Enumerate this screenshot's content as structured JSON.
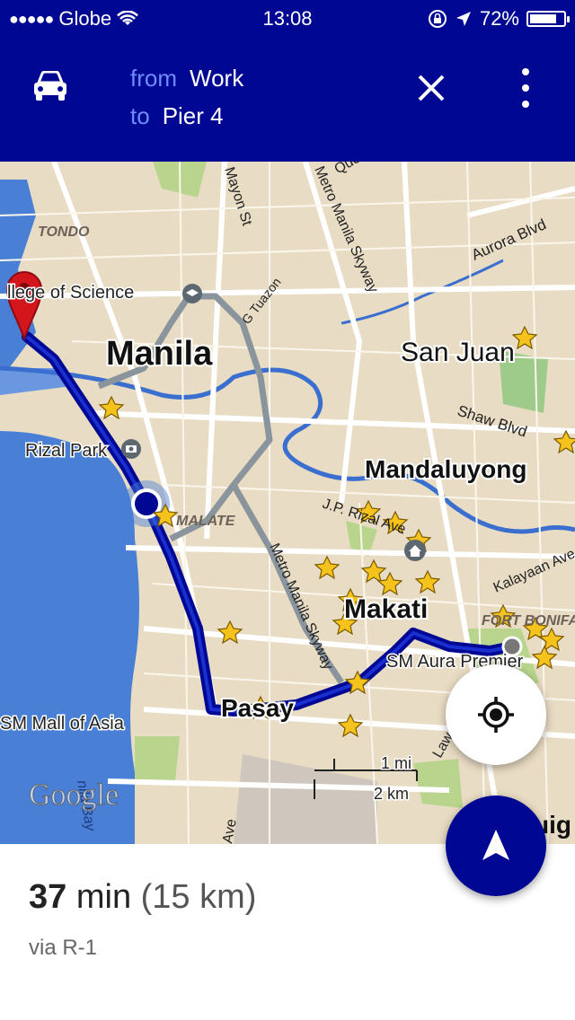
{
  "status_bar": {
    "carrier": "Globe",
    "time": "13:08",
    "battery": "72%",
    "battery_level": 0.72
  },
  "header": {
    "from_label": "from",
    "from_value": "Work",
    "to_label": "to",
    "to_value": "Pier 4",
    "mode_icon": "car-icon",
    "close_icon": "close-icon",
    "more_icon": "more-vert-icon"
  },
  "map": {
    "places": {
      "tondo": "TONDO",
      "manila": "Manila",
      "college": "llege of Science",
      "san_juan": "San Juan",
      "aurora": "Aurora Blvd",
      "shaw": "Shaw Blvd",
      "mandaluyong": "Mandaluyong",
      "rizal_park": "Rizal Park",
      "malate": "MALATE",
      "jp_rizal": "J.P. Rizal Ave",
      "kalayaan": "Kalayaan Ave",
      "makati": "Makati",
      "fort": "FORT BONIFA",
      "sm_aura": "SM Aura Premier",
      "pasay": "Pasay",
      "sm_mall": "SM Mall of Asia",
      "mayon": "Mayon St",
      "skyway_north": "Metro Manila Skyway",
      "skyway_south": "Metro Manila Skyway",
      "tuazon": "G Tuazon",
      "que": "Que",
      "manila_bay": "nila Bay",
      "ave": "Ave",
      "law": "Law",
      "guig": "uig"
    },
    "watermark": "Google",
    "scale": {
      "mi": "1 mi",
      "km": "2 km"
    },
    "colors": {
      "route": "#000893",
      "alt_route": "#8a949c",
      "water": "#4a7fd6",
      "land": "#e9dcc4",
      "marker": "#d3151c"
    }
  },
  "buttons": {
    "locate_icon": "my-location-icon",
    "navigate_icon": "navigation-arrow-icon"
  },
  "summary": {
    "minutes": "37",
    "min_unit": "min",
    "distance": "(15 km)",
    "via": "via R-1"
  }
}
